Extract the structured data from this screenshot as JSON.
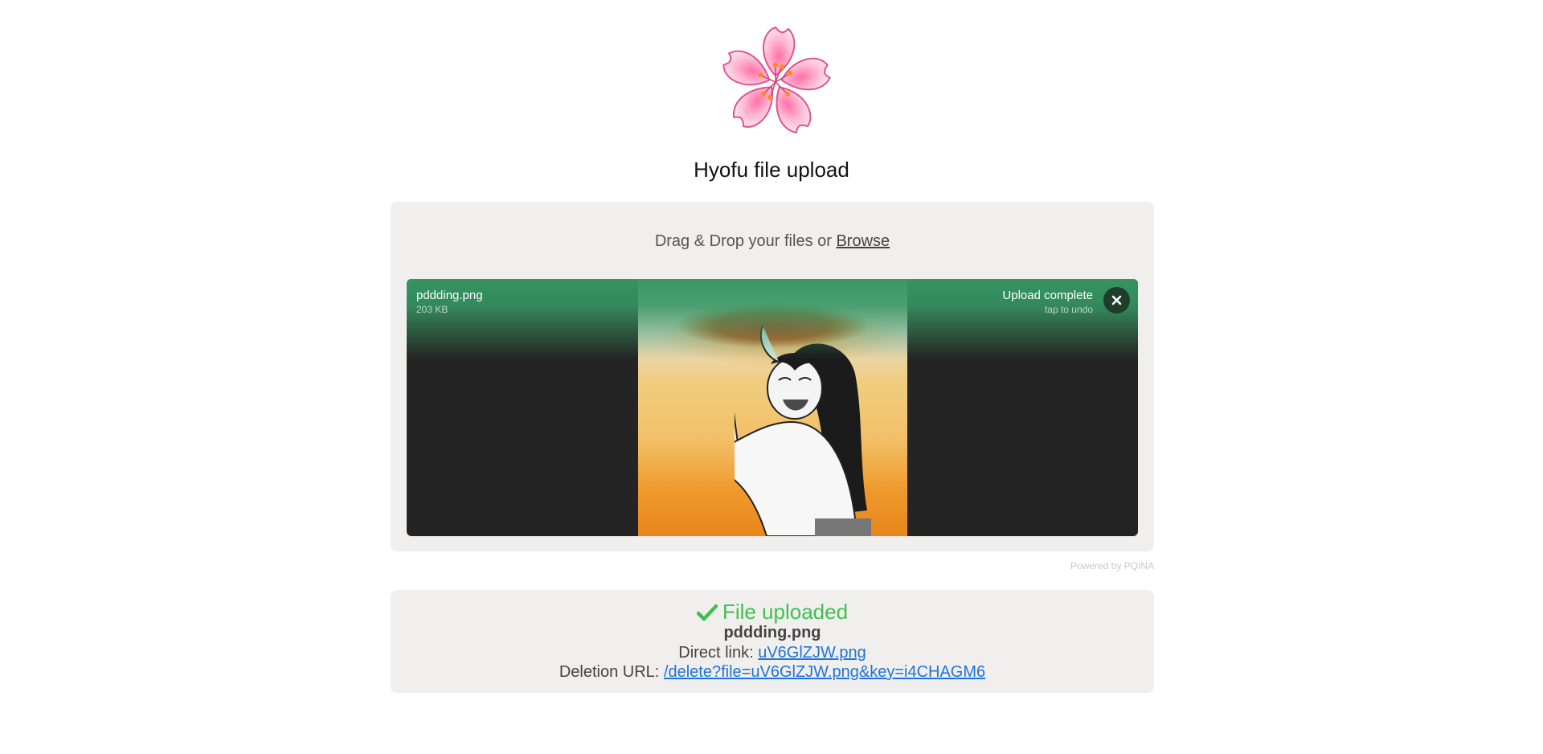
{
  "page": {
    "title": "Hyofu file upload"
  },
  "upload": {
    "drop_text": "Drag & Drop your files or",
    "browse_label": "Browse",
    "file": {
      "name": "pddding.png",
      "size": "203 KB",
      "status": "Upload complete",
      "status_hint": "tap to undo"
    },
    "powered_by": "Powered by PQINA"
  },
  "result": {
    "title": "File uploaded",
    "filename": "pddding.png",
    "direct_label": "Direct link:",
    "direct_link": "uV6GlZJW.png",
    "deletion_label": "Deletion URL:",
    "deletion_link": "/delete?file=uV6GlZJW.png&key=i4CHAGM6"
  },
  "colors": {
    "success": "#3fbf54",
    "upload_overlay": "#369662",
    "link": "#1f73d9",
    "panel": "#f0efed"
  },
  "icons": {
    "logo": "cherry-blossom-icon",
    "undo": "close-icon",
    "success": "checkmark-icon"
  }
}
